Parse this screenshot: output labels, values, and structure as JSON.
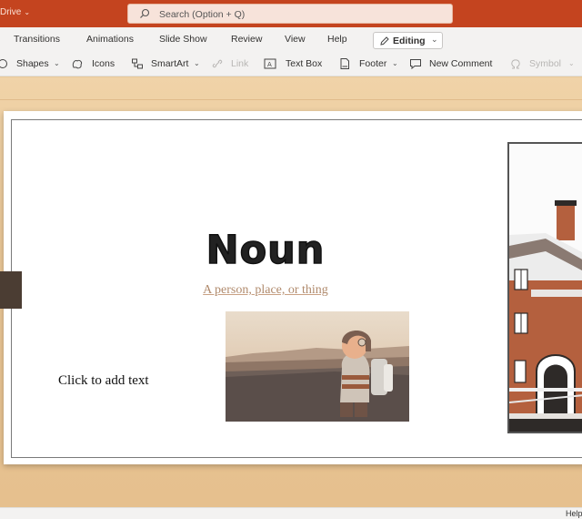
{
  "titlebar": {
    "app_name": "Drive",
    "search_placeholder": "Search (Option + Q)"
  },
  "tabs": [
    {
      "label": "Transitions"
    },
    {
      "label": "Animations"
    },
    {
      "label": "Slide Show"
    },
    {
      "label": "Review"
    },
    {
      "label": "View"
    },
    {
      "label": "Help"
    }
  ],
  "editing": {
    "label": "Editing"
  },
  "ribbon": {
    "shapes": "Shapes",
    "icons": "Icons",
    "smartart": "SmartArt",
    "link": "Link",
    "textbox": "Text Box",
    "footer": "Footer",
    "new_comment": "New Comment",
    "symbol": "Symbol"
  },
  "slide": {
    "title": "Noun",
    "subtitle": "A person, place, or thing",
    "placeholder": "Click to add text"
  },
  "statusbar": {
    "help": "Help"
  },
  "colors": {
    "title_bar": "#c4441f",
    "ribbon": "#f3f2f1",
    "workspace": "#e9c696"
  }
}
